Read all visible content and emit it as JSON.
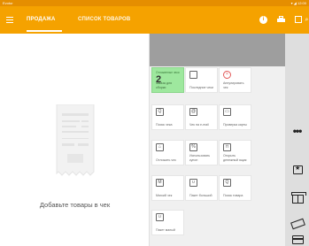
{
  "status_bar": {
    "left_text": "Evotor",
    "right_text": "▾ ◢ 12:00"
  },
  "app_bar": {
    "tabs": [
      {
        "label": "ПРОДАЖА",
        "active": true
      },
      {
        "label": "СПИСОК ТОВАРОВ",
        "active": false
      }
    ],
    "actions": [
      "info-icon",
      "print-icon",
      "barcode-icon",
      "search-icon"
    ]
  },
  "receipt": {
    "empty_message": "Добавьте товары в чек"
  },
  "tiles": [
    {
      "id": "deferred",
      "small": "Отложенные чеки",
      "count": "2",
      "label": "заказа для сборки",
      "icon": "",
      "accent": "#9ee89e"
    },
    {
      "id": "last-receipt",
      "label": "Последние чеки",
      "icon": "receipt-icon"
    },
    {
      "id": "annul",
      "label": "Аннулировать чек",
      "icon": "cancel-icon"
    },
    {
      "id": "find-receipt",
      "label": "Поиск чека",
      "icon": "search-icon"
    },
    {
      "id": "email-receipt",
      "label": "Чек на e-mail",
      "icon": "at-icon"
    },
    {
      "id": "card-check",
      "label": "Проверка карты",
      "icon": "card-icon"
    },
    {
      "id": "defer",
      "label": "Отложить чек",
      "icon": "lock-icon"
    },
    {
      "id": "coupon",
      "label": "Использовать купон",
      "icon": "percent-icon"
    },
    {
      "id": "drawer",
      "label": "Открыть денежный ящик",
      "icon": "cashbox-icon"
    },
    {
      "id": "soft-receipt",
      "label": "Мягкий чек",
      "icon": "soft-icon"
    },
    {
      "id": "big-bag",
      "label": "Пакет большой",
      "icon": "bag-icon"
    },
    {
      "id": "find-goods",
      "label": "Поиск товара",
      "icon": "magnifier-icon"
    },
    {
      "id": "small-bag",
      "label": "Пакет малый",
      "icon": "bag-icon"
    }
  ],
  "side_actions": [
    "more-icon",
    "discount-icon",
    "gift-icon",
    "cash-icon",
    "card-icon"
  ]
}
